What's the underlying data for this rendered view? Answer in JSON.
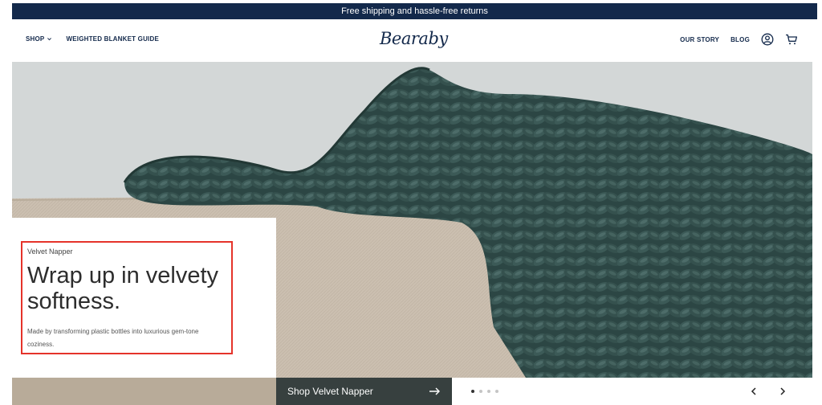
{
  "announcement": {
    "text": "Free shipping and hassle-free returns"
  },
  "header": {
    "nav_left": [
      {
        "label": "SHOP",
        "has_dropdown": true
      },
      {
        "label": "WEIGHTED BLANKET GUIDE"
      }
    ],
    "logo": "Bearaby",
    "nav_right": [
      {
        "label": "OUR STORY"
      },
      {
        "label": "BLOG"
      }
    ],
    "icons": [
      "account-icon",
      "cart-icon"
    ]
  },
  "hero": {
    "eyebrow": "Velvet Napper",
    "headline": "Wrap up in velvety softness.",
    "description": "Made by transforming plastic bottles into luxurious gem-tone coziness.",
    "cta_label": "Shop Velvet Napper",
    "carousel": {
      "slides": 4,
      "active": 1
    }
  },
  "colors": {
    "navy": "#13294b",
    "sky": "#d3d7d7",
    "blanket": "#2f4a48",
    "linen": "#cbbfb0",
    "cta": "#37403f",
    "highlight": "#e5332a"
  }
}
